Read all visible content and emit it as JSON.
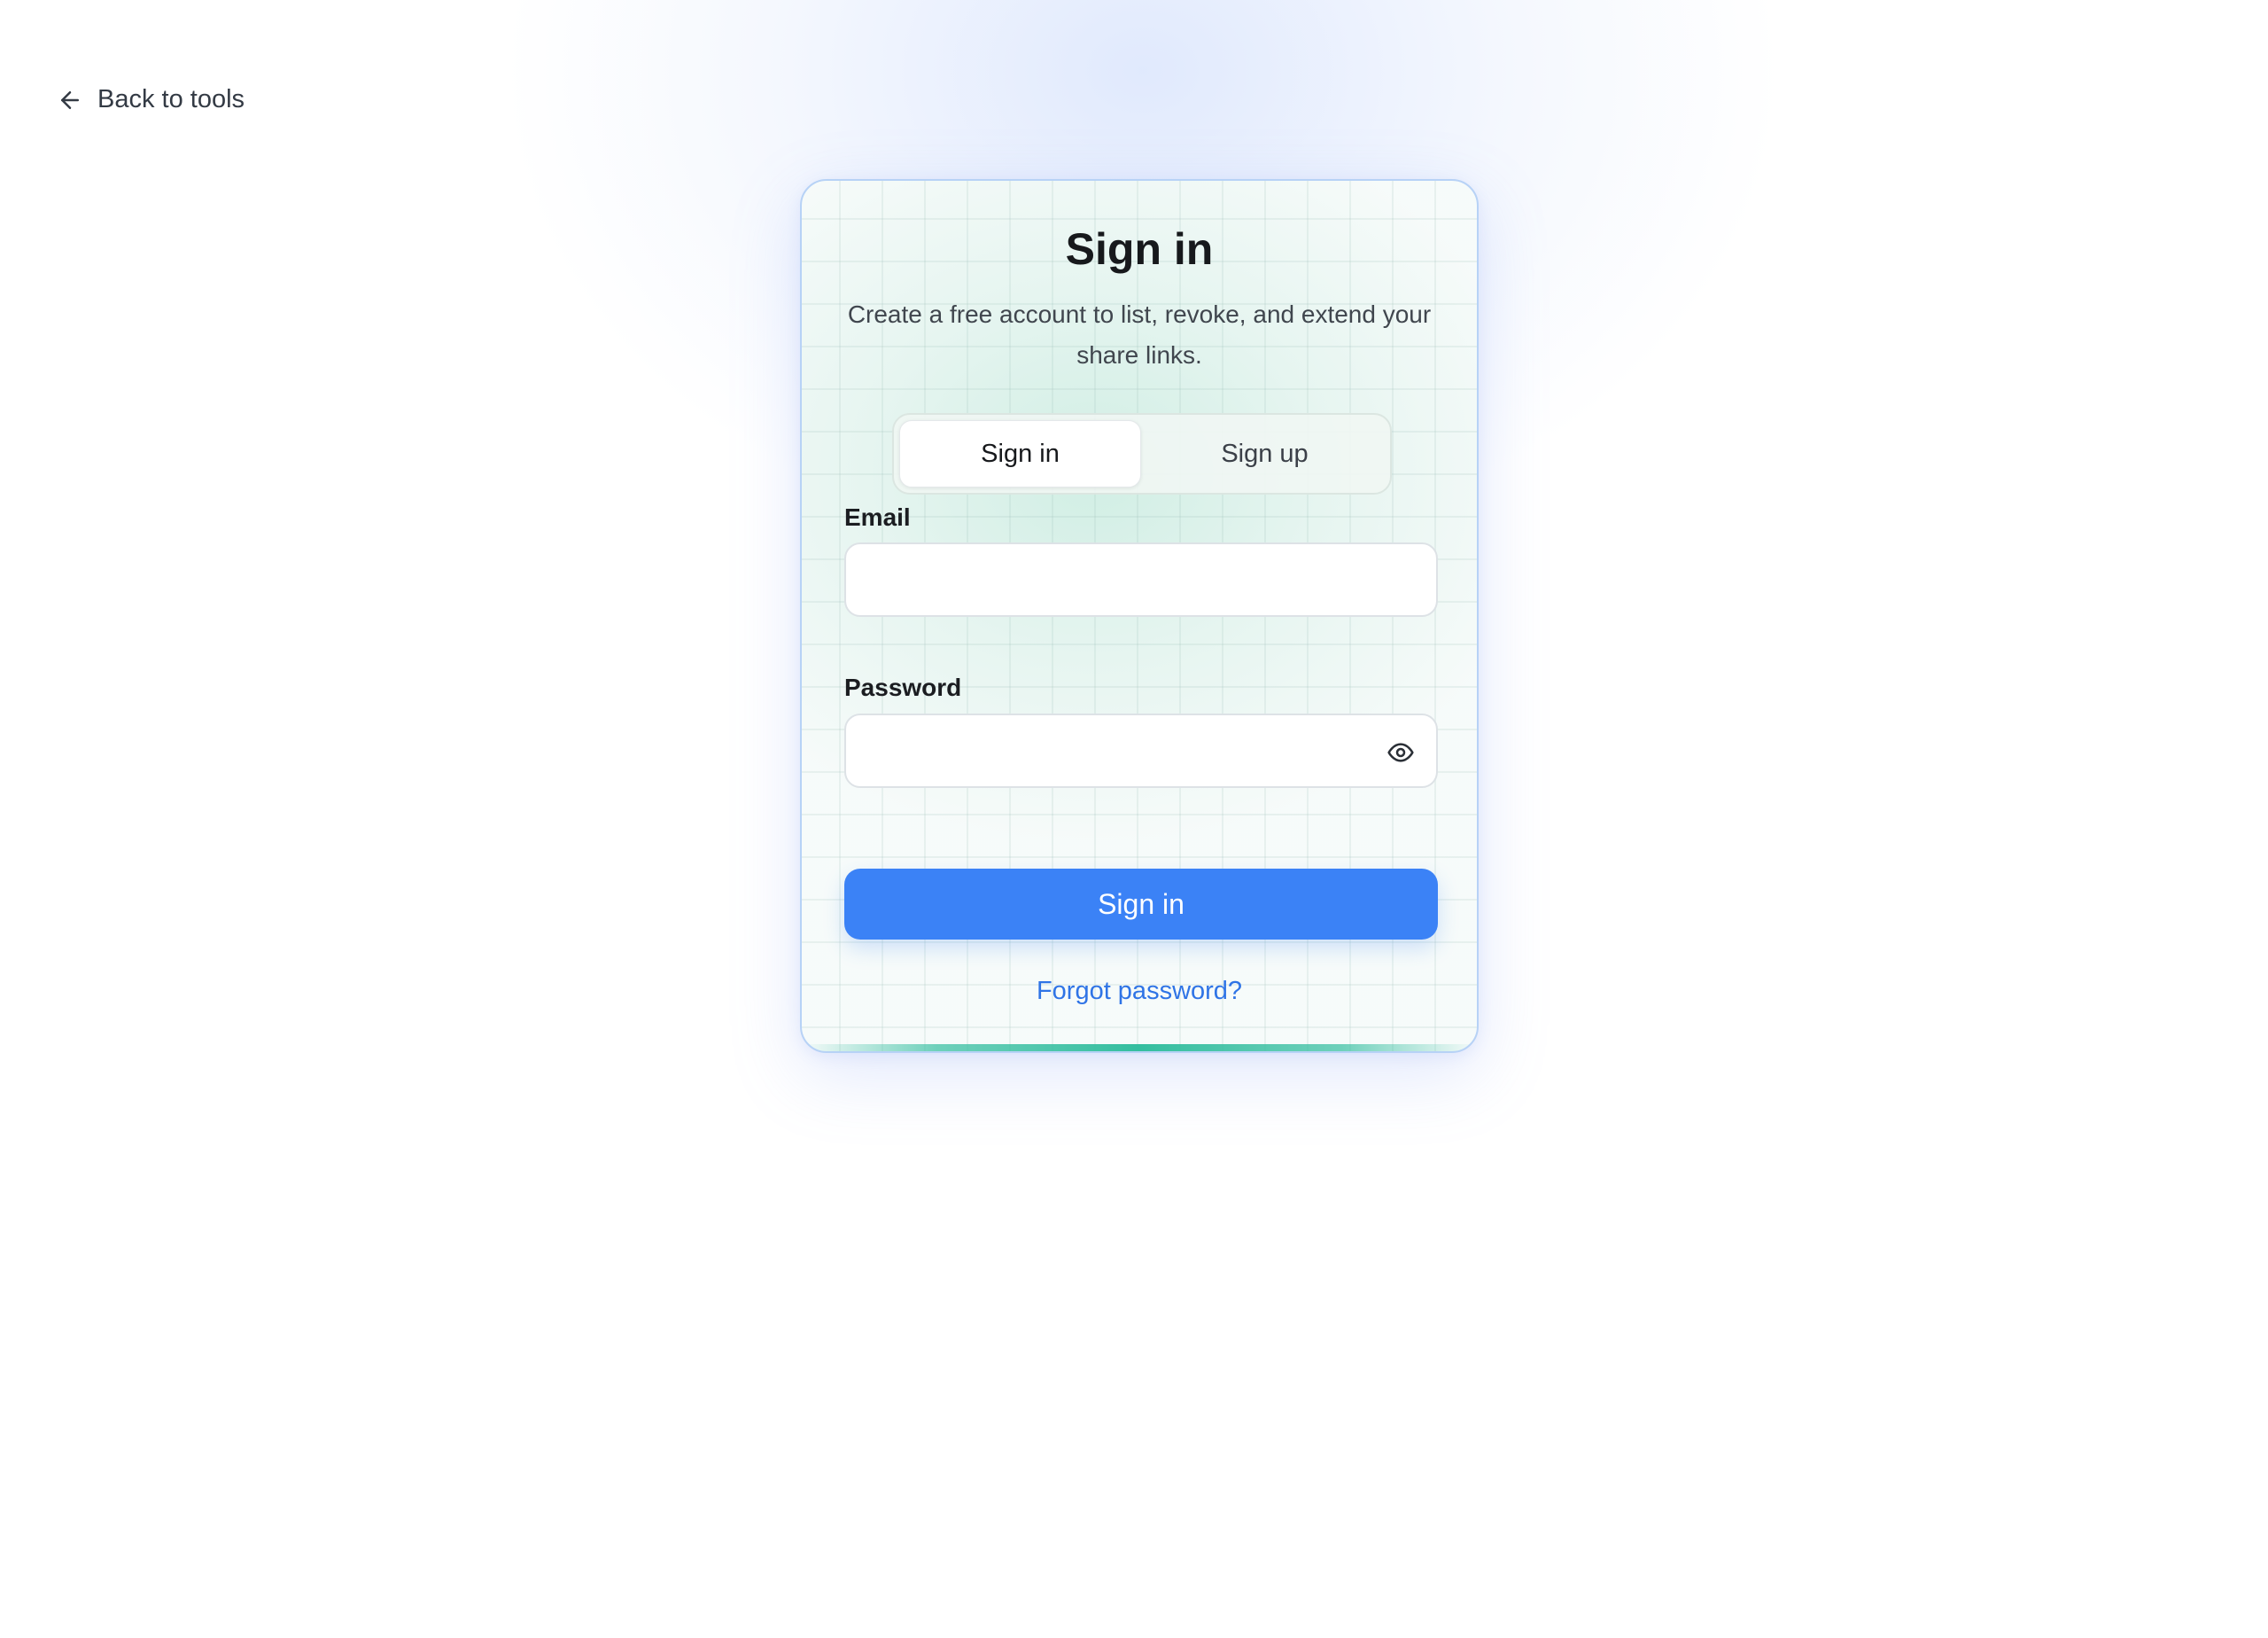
{
  "nav": {
    "back_label": "Back to tools",
    "back_icon": "arrow-left-icon"
  },
  "auth": {
    "title": "Sign in",
    "subtitle": "Create a free account to list, revoke, and extend your share links.",
    "tabs": [
      {
        "label": "Sign in",
        "active": true
      },
      {
        "label": "Sign up",
        "active": false
      }
    ],
    "email": {
      "label": "Email",
      "value": "",
      "placeholder": ""
    },
    "password": {
      "label": "Password",
      "value": "",
      "placeholder": "",
      "toggle_icon": "eye-icon"
    },
    "submit_label": "Sign in",
    "forgot_label": "Forgot password?"
  },
  "colors": {
    "primary": "#3b82f6",
    "link": "#2f74e6",
    "accent": "#34be9f",
    "card_border": "#b7d2f6"
  }
}
